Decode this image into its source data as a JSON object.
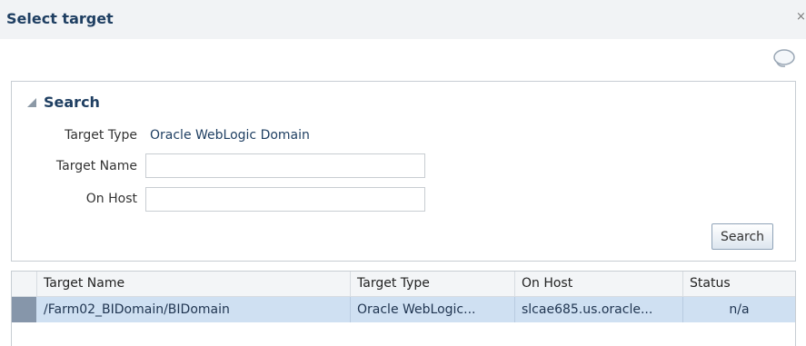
{
  "dialog": {
    "title": "Select target",
    "close_label": "×"
  },
  "search": {
    "title": "Search",
    "target_type_label": "Target Type",
    "target_type_value": "Oracle WebLogic Domain",
    "target_name_label": "Target Name",
    "target_name_value": "",
    "on_host_label": "On Host",
    "on_host_value": "",
    "button_label": "Search"
  },
  "results": {
    "columns": [
      "Target Name",
      "Target Type",
      "On Host",
      "Status"
    ],
    "rows": [
      {
        "target_name": "/Farm02_BIDomain/BIDomain",
        "target_type": "Oracle WebLogic...",
        "on_host": "slcae685.us.oracle...",
        "status": "n/a",
        "selected": true
      }
    ]
  },
  "icons": {
    "collapse": "triangle-collapse-icon",
    "help": "chat-bubble-icon"
  },
  "colors": {
    "title_text": "#1f3f62",
    "header_bg": "#f1f3f5",
    "selected_row_bg": "#cfe0f2",
    "row_selector": "#8696aa"
  }
}
